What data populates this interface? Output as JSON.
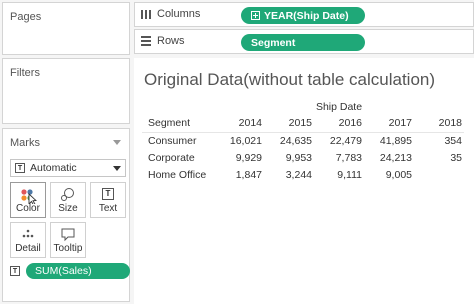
{
  "pages": {
    "title": "Pages"
  },
  "filters": {
    "title": "Filters"
  },
  "marks": {
    "title": "Marks",
    "mark_type": "Automatic",
    "buttons": [
      {
        "label": "Color"
      },
      {
        "label": "Size"
      },
      {
        "label": "Text"
      },
      {
        "label": "Detail"
      },
      {
        "label": "Tooltip"
      }
    ],
    "field": "SUM(Sales)"
  },
  "shelves": {
    "columns": {
      "label": "Columns",
      "pill": "YEAR(Ship Date)"
    },
    "rows": {
      "label": "Rows",
      "pill": "Segment"
    }
  },
  "view": {
    "title": "Original Data(without table calculation)",
    "group_header": "Ship Date",
    "row_header": "Segment",
    "years": [
      "2014",
      "2015",
      "2016",
      "2017",
      "2018"
    ],
    "rows": [
      {
        "segment": "Consumer",
        "values": [
          "16,021",
          "24,635",
          "22,479",
          "41,895",
          "354"
        ]
      },
      {
        "segment": "Corporate",
        "values": [
          "9,929",
          "9,953",
          "7,783",
          "24,213",
          "35"
        ]
      },
      {
        "segment": "Home Office",
        "values": [
          "1,847",
          "3,244",
          "9,111",
          "9,005",
          ""
        ]
      }
    ]
  },
  "colors": {
    "pill": "#1fa878",
    "panel_bg": "#f5f5f5"
  }
}
